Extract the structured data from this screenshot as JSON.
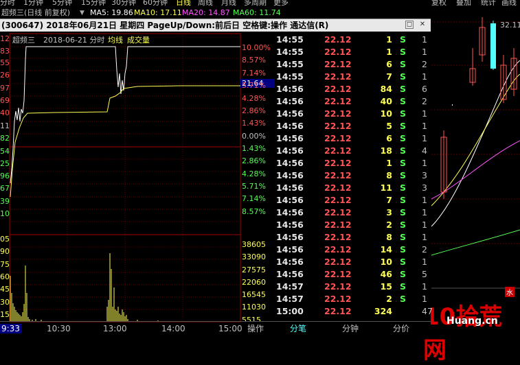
{
  "toolbar": {
    "items": [
      "分时",
      "1分钟",
      "5分钟",
      "15分钟",
      "30分钟",
      "60分钟",
      "日线",
      "周线",
      "月线",
      "多周期",
      "更多"
    ],
    "active": "日线",
    "right_items": [
      "复权",
      "叠加",
      "统计",
      "画线"
    ]
  },
  "ma_bar": {
    "title": "超频三(日线 前复权)",
    "ma5": "MA5: 19.86",
    "ma10": "MA10: 17.11",
    "ma20": "MA20: 14.87",
    "ma60": "MA60: 11.74",
    "colors": {
      "ma5": "#ffffff",
      "ma10": "#ffff54",
      "ma20": "#ff54ff",
      "ma60": "#54ff54"
    }
  },
  "popup": {
    "title": "(300647) 2018年06月21日 星期四 PageUp/Down:前后日 空格键:操作 通达信(R)",
    "chart_header": {
      "name": "超频三",
      "date": "2018-06-21 分时",
      "avg_label": "均线",
      "vol_label": "成交量"
    },
    "cursor_price": "21.64",
    "left_price_labels": [
      "12",
      "83",
      "55",
      "26",
      "97",
      "69",
      "40",
      "11",
      "82",
      "54",
      "25",
      "96",
      "67",
      "39",
      "10"
    ],
    "left_vol_labels": [
      "05",
      "90",
      "75",
      "60",
      "45",
      "30",
      "15"
    ],
    "pct_labels": [
      "10.00%",
      "8.57%",
      "7.14%",
      "5.71%",
      "4.28%",
      "2.86%",
      "1.43%",
      "0.00%",
      "1.43%",
      "2.86%",
      "4.28%",
      "5.71%",
      "7.14%",
      "8.57%"
    ],
    "vol_labels": [
      "38605",
      "33090",
      "27575",
      "22060",
      "16545",
      "11030",
      "5515"
    ],
    "time_axis": [
      "9:33",
      "10:30",
      "13:00",
      "14:00",
      "15:00"
    ],
    "ticks": [
      {
        "time": "14:55",
        "price": "22.12",
        "vol": "1",
        "flag": "S",
        "n": "1"
      },
      {
        "time": "14:55",
        "price": "22.12",
        "vol": "1",
        "flag": "S",
        "n": "1"
      },
      {
        "time": "14:55",
        "price": "22.12",
        "vol": "6",
        "flag": "S",
        "n": "2"
      },
      {
        "time": "14:55",
        "price": "22.12",
        "vol": "7",
        "flag": "S",
        "n": "1"
      },
      {
        "time": "14:56",
        "price": "22.12",
        "vol": "84",
        "flag": "S",
        "n": "6"
      },
      {
        "time": "14:56",
        "price": "22.12",
        "vol": "40",
        "flag": "S",
        "n": "2"
      },
      {
        "time": "14:56",
        "price": "22.12",
        "vol": "10",
        "flag": "S",
        "n": "1"
      },
      {
        "time": "14:56",
        "price": "22.12",
        "vol": "5",
        "flag": "S",
        "n": "1"
      },
      {
        "time": "14:56",
        "price": "22.12",
        "vol": "6",
        "flag": "S",
        "n": "1"
      },
      {
        "time": "14:56",
        "price": "22.12",
        "vol": "18",
        "flag": "S",
        "n": "4"
      },
      {
        "time": "14:56",
        "price": "22.12",
        "vol": "1",
        "flag": "S",
        "n": "1"
      },
      {
        "time": "14:56",
        "price": "22.12",
        "vol": "8",
        "flag": "S",
        "n": "3"
      },
      {
        "time": "14:56",
        "price": "22.12",
        "vol": "11",
        "flag": "S",
        "n": "3"
      },
      {
        "time": "14:56",
        "price": "22.12",
        "vol": "7",
        "flag": "S",
        "n": "1"
      },
      {
        "time": "14:56",
        "price": "22.12",
        "vol": "3",
        "flag": "S",
        "n": "1"
      },
      {
        "time": "14:56",
        "price": "22.12",
        "vol": "2",
        "flag": "S",
        "n": "1"
      },
      {
        "time": "14:56",
        "price": "22.12",
        "vol": "8",
        "flag": "S",
        "n": "1"
      },
      {
        "time": "14:56",
        "price": "22.12",
        "vol": "14",
        "flag": "S",
        "n": "2"
      },
      {
        "time": "14:56",
        "price": "22.12",
        "vol": "10",
        "flag": "S",
        "n": "1"
      },
      {
        "time": "14:56",
        "price": "22.12",
        "vol": "46",
        "flag": "S",
        "n": "5"
      },
      {
        "time": "14:57",
        "price": "22.12",
        "vol": "15",
        "flag": "S",
        "n": "1"
      },
      {
        "time": "14:57",
        "price": "22.12",
        "vol": "2",
        "flag": "S",
        "n": "1"
      },
      {
        "time": "15:00",
        "price": "22.12",
        "vol": "324",
        "flag": "",
        "n": "47"
      }
    ],
    "tabs": [
      "操作",
      "分笔",
      "分钟",
      "分价"
    ],
    "active_tab": "分笔"
  },
  "right_panel": {
    "price_label": "32.11",
    "watermark": "10拾荒网",
    "watermark_url": "Huang.cn",
    "badge": "水"
  }
}
